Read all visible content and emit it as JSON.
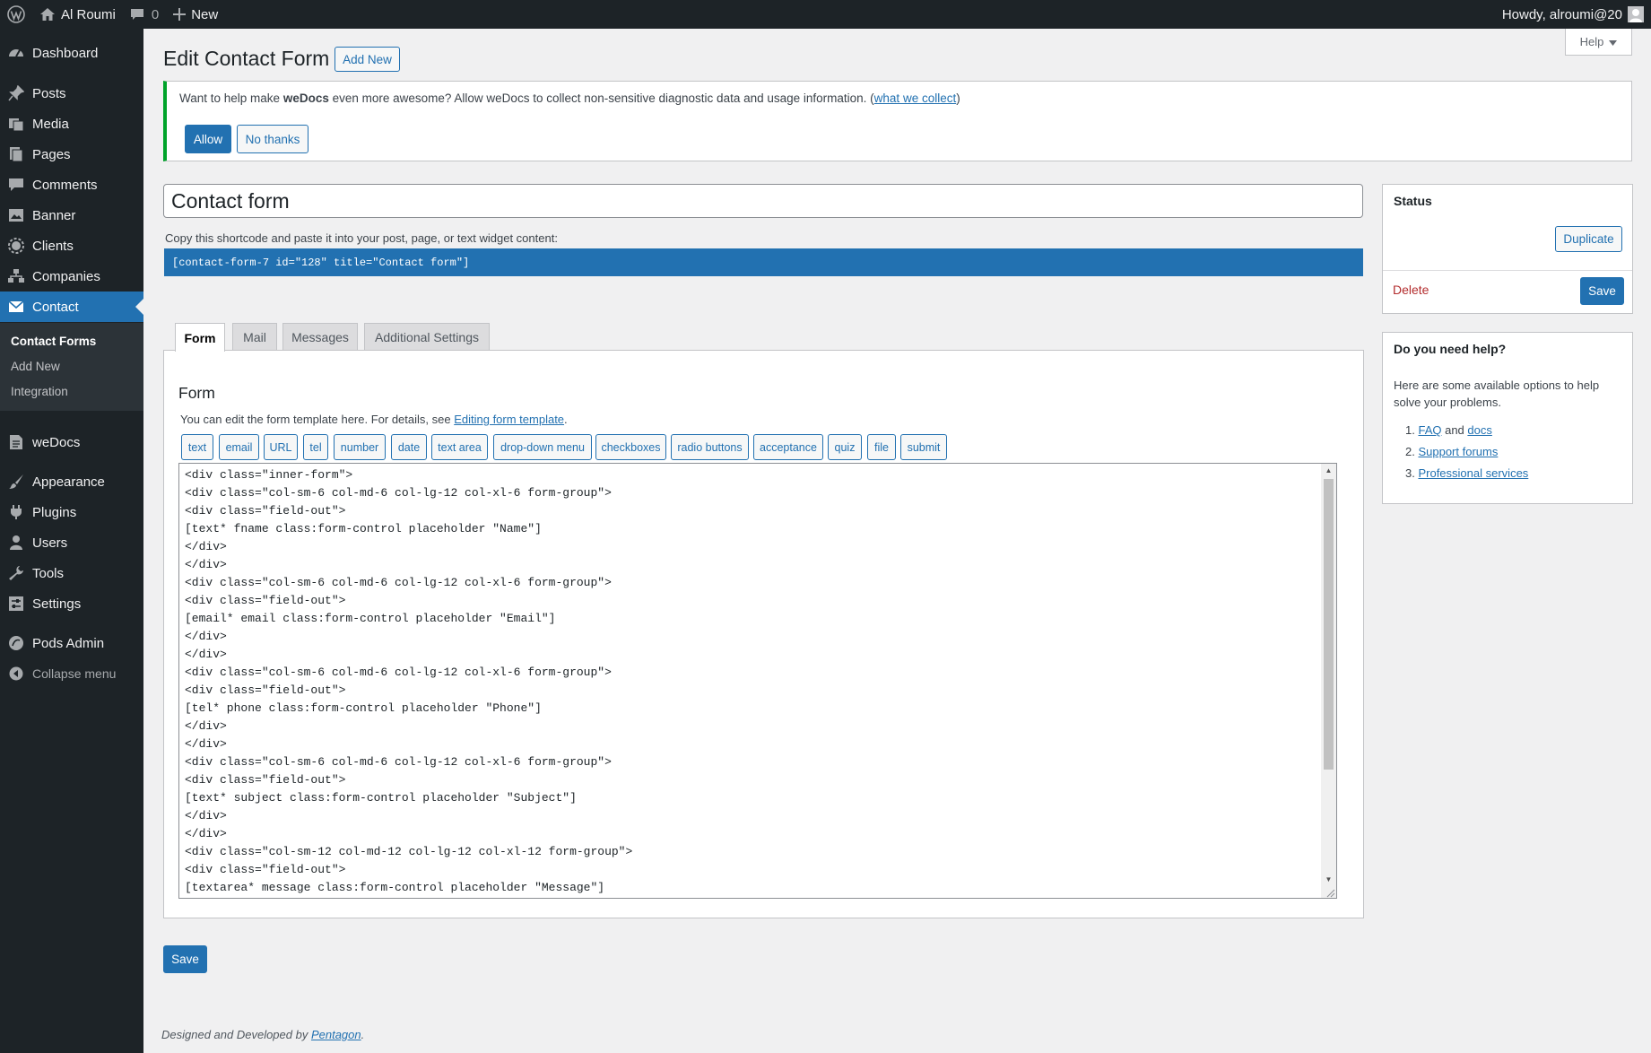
{
  "admin_bar": {
    "site_name": "Al Roumi",
    "comments_count": "0",
    "new_label": "New",
    "howdy": "Howdy, alroumi@20"
  },
  "sidebar": {
    "items": [
      {
        "label": "Dashboard",
        "icon": "dashboard-icon"
      },
      {
        "label": "Posts",
        "icon": "pin-icon"
      },
      {
        "label": "Media",
        "icon": "media-icon"
      },
      {
        "label": "Pages",
        "icon": "pages-icon"
      },
      {
        "label": "Comments",
        "icon": "comments-icon"
      },
      {
        "label": "Banner",
        "icon": "banner-icon"
      },
      {
        "label": "Clients",
        "icon": "clients-icon"
      },
      {
        "label": "Companies",
        "icon": "companies-icon"
      },
      {
        "label": "Contact",
        "icon": "mail-icon"
      },
      {
        "label": "weDocs",
        "icon": "docs-icon"
      },
      {
        "label": "Appearance",
        "icon": "brush-icon"
      },
      {
        "label": "Plugins",
        "icon": "plugin-icon"
      },
      {
        "label": "Users",
        "icon": "users-icon"
      },
      {
        "label": "Tools",
        "icon": "wrench-icon"
      },
      {
        "label": "Settings",
        "icon": "settings-icon"
      },
      {
        "label": "Pods Admin",
        "icon": "pods-icon"
      },
      {
        "label": "Collapse menu",
        "icon": "collapse-icon"
      }
    ],
    "submenu": [
      "Contact Forms",
      "Add New",
      "Integration"
    ]
  },
  "page": {
    "title": "Edit Contact Form",
    "add_new": "Add New",
    "help": "Help"
  },
  "notice": {
    "text_before": "Want to help make ",
    "brand": "weDocs",
    "text_after": " even more awesome? Allow weDocs to collect non-sensitive diagnostic data and usage information. (",
    "link": "what we collect",
    "text_end": ")",
    "allow": "Allow",
    "no_thanks": "No thanks"
  },
  "form": {
    "title_value": "Contact form",
    "shortcode_label": "Copy this shortcode and paste it into your post, page, or text widget content:",
    "shortcode": "[contact-form-7 id=\"128\" title=\"Contact form\"]",
    "tabs": [
      "Form",
      "Mail",
      "Messages",
      "Additional Settings"
    ],
    "panel_title": "Form",
    "desc_before": "You can edit the form template here. For details, see ",
    "desc_link": "Editing form template",
    "desc_after": ".",
    "tag_buttons": [
      "text",
      "email",
      "URL",
      "tel",
      "number",
      "date",
      "text area",
      "drop-down menu",
      "checkboxes",
      "radio buttons",
      "acceptance",
      "quiz",
      "file",
      "submit"
    ],
    "code_lines": [
      "<div class=\"inner-form\">",
      "<div class=\"col-sm-6 col-md-6 col-lg-12 col-xl-6 form-group\">",
      "<div class=\"field-out\">",
      "[text* fname class:form-control placeholder \"Name\"]",
      "</div>",
      "</div>",
      "<div class=\"col-sm-6 col-md-6 col-lg-12 col-xl-6 form-group\">",
      "<div class=\"field-out\">",
      "[email* email class:form-control placeholder \"Email\"]",
      "</div>",
      "</div>",
      "<div class=\"col-sm-6 col-md-6 col-lg-12 col-xl-6 form-group\">",
      "<div class=\"field-out\">",
      "[tel* phone class:form-control placeholder \"Phone\"]",
      "</div>",
      "</div>",
      "<div class=\"col-sm-6 col-md-6 col-lg-12 col-xl-6 form-group\">",
      "<div class=\"field-out\">",
      "[text* subject class:form-control placeholder \"Subject\"]",
      "</div>",
      "</div>",
      "<div class=\"col-sm-12 col-md-12 col-lg-12 col-xl-12 form-group\">",
      "<div class=\"field-out\">",
      "[textarea* message class:form-control placeholder \"Message\"]"
    ],
    "save": "Save"
  },
  "status_box": {
    "title": "Status",
    "duplicate": "Duplicate",
    "delete": "Delete",
    "save": "Save"
  },
  "help_box": {
    "title": "Do you need help?",
    "text": "Here are some available options to help solve your problems.",
    "items": [
      {
        "num": "1.",
        "link1": "FAQ",
        "and": " and ",
        "link2": "docs"
      },
      {
        "num": "2.",
        "link1": "Support forums"
      },
      {
        "num": "3.",
        "link1": "Professional services"
      }
    ]
  },
  "footer": {
    "text": "Designed and Developed by ",
    "link": "Pentagon",
    "end": "."
  },
  "colors": {
    "admin_bg": "#1d2327",
    "accent": "#2271b1",
    "notice_border": "#00a32a",
    "delete": "#b32d2e"
  }
}
